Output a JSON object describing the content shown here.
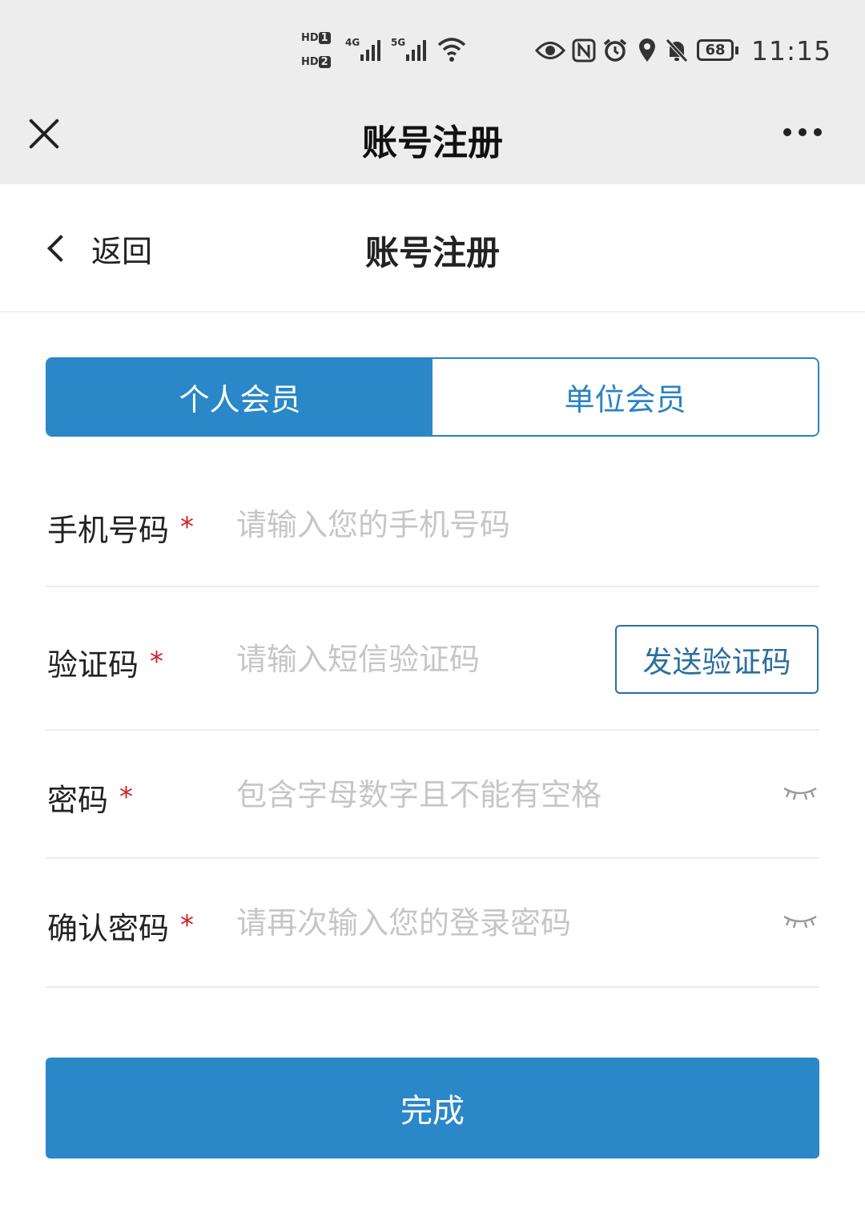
{
  "status_bar": {
    "hd1": "HD",
    "hd1_sim": "1",
    "hd2": "HD",
    "hd2_sim": "2",
    "net1": "4G",
    "net2": "5G",
    "battery": "68",
    "time": "11:15"
  },
  "app_bar": {
    "title": "账号注册"
  },
  "page_header": {
    "back_label": "返回",
    "title": "账号注册"
  },
  "member_tabs": [
    {
      "label": "个人会员",
      "active": true
    },
    {
      "label": "单位会员",
      "active": false
    }
  ],
  "form": {
    "phone": {
      "label": "手机号码",
      "required_mark": "*",
      "placeholder": "请输入您的手机号码"
    },
    "code": {
      "label": "验证码",
      "required_mark": "*",
      "placeholder": "请输入短信验证码",
      "send_button": "发送验证码"
    },
    "password": {
      "label": "密码",
      "required_mark": "*",
      "placeholder": "包含字母数字且不能有空格"
    },
    "confirm_password": {
      "label": "确认密码",
      "required_mark": "*",
      "placeholder": "请再次输入您的登录密码"
    }
  },
  "submit_label": "完成",
  "colors": {
    "accent": "#2a87c8",
    "required": "#d0202a",
    "topbar_bg": "#ededed"
  }
}
